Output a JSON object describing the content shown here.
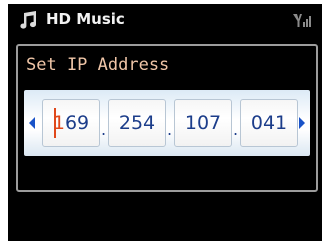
{
  "statusbar": {
    "title": "HD Music",
    "left_icon": "music-note-icon",
    "right_icon": "wifi-signal-icon"
  },
  "dialog": {
    "prompt": "Set IP Address",
    "ip": {
      "octets": [
        "169",
        "254",
        "107",
        "041"
      ],
      "separator": ".",
      "focused_octet_index": 0
    },
    "nav_left_icon": "arrow-left-icon",
    "nav_right_icon": "arrow-right-icon"
  },
  "colors": {
    "screen_bg": "#000000",
    "prompt_text": "#f0c6a8",
    "accent_blue": "#1a53c8",
    "active_digit": "#e0481a",
    "panel_border": "#9c9c9c"
  }
}
